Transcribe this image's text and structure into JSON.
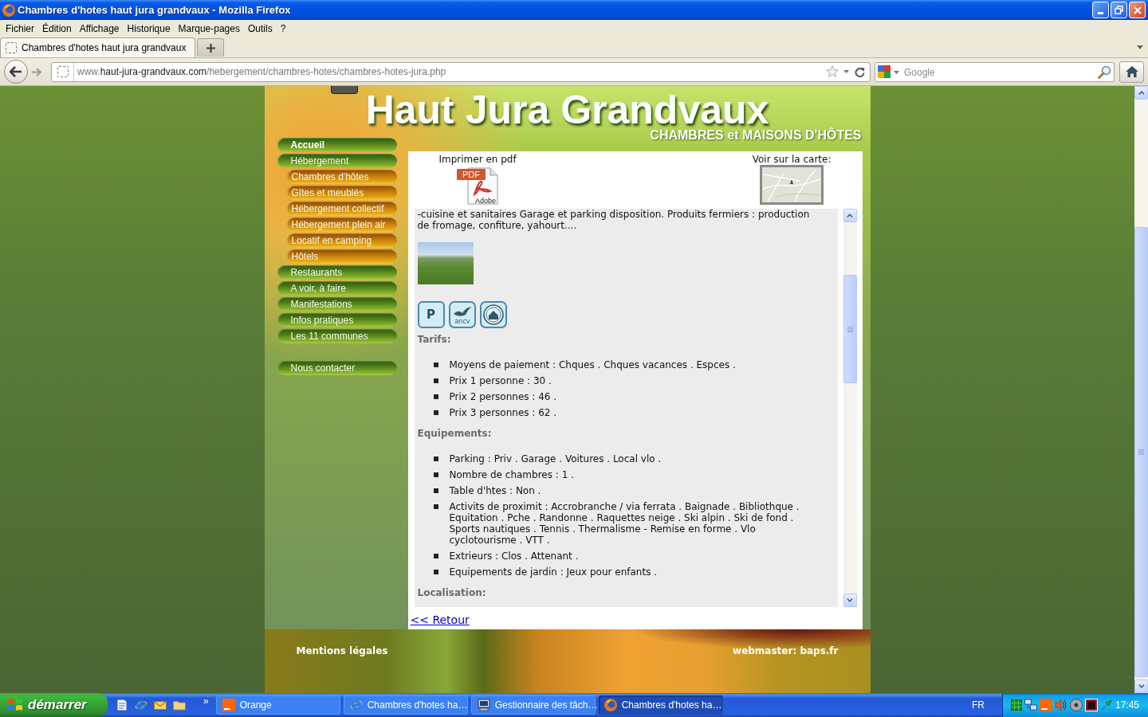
{
  "window": {
    "title": "Chambres d'hotes haut jura grandvaux - Mozilla Firefox"
  },
  "menu_bar": [
    "Fichier",
    "Édition",
    "Affichage",
    "Historique",
    "Marque-pages",
    "Outils",
    "?"
  ],
  "tabs": [
    {
      "label": "Chambres d'hotes haut jura grandvaux",
      "selected": true
    }
  ],
  "address_bar": {
    "prefix": "www.",
    "host": "haut-jura-grandvaux.com",
    "path": "/hebergement/chambres-hotes/chambres-hotes-jura.php"
  },
  "search": {
    "placeholder": "Google"
  },
  "site": {
    "title": "Haut Jura Grandvaux",
    "subtitle": "CHAMBRES et MAISONS D'HÔTES"
  },
  "sidebar": {
    "items": [
      {
        "label": "Accueil",
        "selected": true
      },
      {
        "label": "Hébergement",
        "selected": false,
        "children": [
          {
            "label": "Chambres d'hôtes",
            "selected": false
          },
          {
            "label": "Gîtes et meublés",
            "selected": false
          },
          {
            "label": "Hébergement collectif",
            "selected": false
          },
          {
            "label": "Hébergement plein air",
            "selected": false
          },
          {
            "label": "Locatif en camping",
            "selected": false
          },
          {
            "label": "Hôtels",
            "selected": false
          }
        ]
      },
      {
        "label": "Restaurants",
        "selected": false
      },
      {
        "label": "A voir, à faire",
        "selected": false
      },
      {
        "label": "Manifestations",
        "selected": false
      },
      {
        "label": "Infos pratiques",
        "selected": false
      },
      {
        "label": "Les 11 communes",
        "selected": false
      }
    ],
    "secondary_items": [
      {
        "label": "Nous contacter",
        "selected": false
      }
    ]
  },
  "content": {
    "pdf": {
      "label": "Imprimer en pdf",
      "icon_tag": "PDF",
      "icon_brand": "Adobe"
    },
    "map": {
      "label": "Voir sur la carte:"
    },
    "intro": "-cuisine et sanitaires Garage et parking disposition. Produits fermiers : production de fromage, confiture, yahourt....",
    "badges": [
      {
        "kind": "parking",
        "text": "P"
      },
      {
        "kind": "ancv",
        "text": "ancv"
      },
      {
        "kind": "seal"
      }
    ],
    "sections": [
      {
        "heading": "Tarifs:",
        "items": [
          "Moyens de paiement : Chques . Chques vacances . Espces .",
          "Prix 1 personne : 30 .",
          "Prix 2 personnes : 46 .",
          "Prix 3 personnes : 62 ."
        ]
      },
      {
        "heading": "Equipements:",
        "items": [
          "Parking : Priv . Garage . Voitures . Local vlo .",
          "Nombre de chambres : 1 .",
          "Table d'htes : Non .",
          "Activits de proximit : Accrobranche / via ferrata . Baignade . Bibliothque . Equitation . Pche . Randonne . Raquettes neige . Ski alpin . Ski de fond . Sports nautiques . Tennis . Thermalisme - Remise en forme . Vlo cyclotourisme . VTT .",
          "Extrieurs : Clos . Attenant .",
          "Equipements de jardin : Jeux pour enfants ."
        ]
      },
      {
        "heading": "Localisation:"
      }
    ],
    "back_link": "<< Retour"
  },
  "footer": {
    "left": "Mentions légales",
    "right": "webmaster: baps.fr"
  },
  "taskbar": {
    "start": "démarrer",
    "more": "»",
    "tasks": [
      {
        "label": "Orange",
        "kind": "square",
        "selected": false
      },
      {
        "label": "Chambres d'hotes ha…",
        "kind": "ie",
        "selected": false
      },
      {
        "label": "Gestionnaire des tâch…",
        "kind": "monitor",
        "selected": false
      },
      {
        "label": "Chambres d'hotes ha…",
        "kind": "globe",
        "selected": true
      }
    ],
    "language": "FR",
    "clock": "17:45"
  }
}
